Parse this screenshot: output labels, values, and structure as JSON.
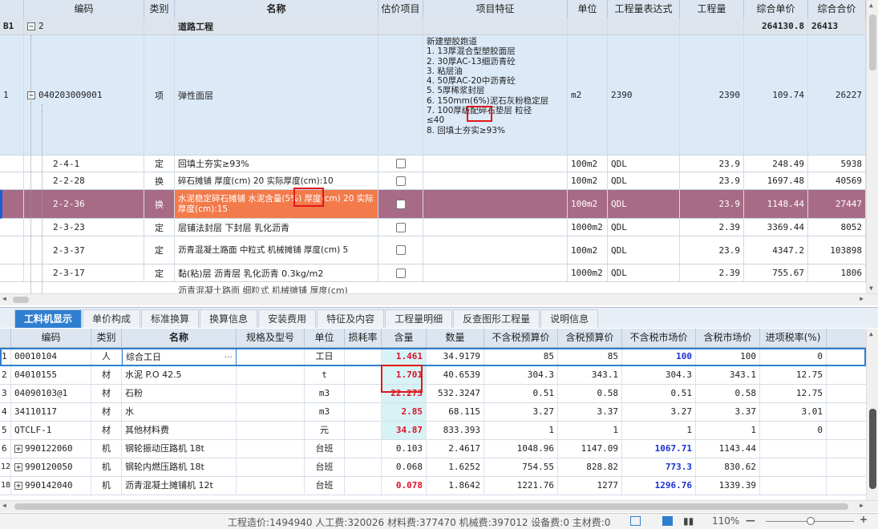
{
  "top_table": {
    "headers": [
      "编码",
      "类别",
      "名称",
      "估价项目",
      "项目特征",
      "单位",
      "工程量表达式",
      "工程量",
      "综合单价",
      "综合合价"
    ],
    "section": {
      "label": "B1",
      "code": "2",
      "name": "道路工程",
      "unit_price": "264130.8",
      "total": "26413"
    },
    "main_item": {
      "row": "1",
      "code": "040203009001",
      "type": "项",
      "name": "弹性面层",
      "features": [
        "新建塑胶跑道",
        "1. 13厚混合型塑胶面层",
        "2. 30厚AC-13细沥青砼",
        "3. 粘层油",
        "4. 50厚AC-20中沥青砼",
        "5. 5厚稀浆封层",
        "6. 150mm(6%)泥石灰粉稳定层",
        "7. 100厚级配碎石垫层 粒径",
        "≤40",
        "8. 回填土夯实≥93%"
      ],
      "unit": "m2",
      "expr": "2390",
      "qty": "2390",
      "unit_price": "109.74",
      "total": "26227"
    },
    "rows": [
      {
        "code": "2-4-1",
        "type": "定",
        "name": "回填土夯实≥93%",
        "unit": "100m2",
        "expr": "QDL",
        "qty": "23.9",
        "unit_price": "248.49",
        "total": "5938"
      },
      {
        "code": "2-2-28",
        "type": "换",
        "name": "碎石摊铺 厚度(cm) 20  实际厚度(cm):10",
        "unit": "100m2",
        "expr": "QDL",
        "qty": "23.9",
        "unit_price": "1697.48",
        "total": "40569"
      },
      {
        "code": "2-2-36",
        "type": "换",
        "name": "水泥稳定碎石摊铺 水泥含量(5%) 厚度(cm) 20  实际厚度(cm):15",
        "unit": "100m2",
        "expr": "QDL",
        "qty": "23.9",
        "unit_price": "1148.44",
        "total": "27447"
      },
      {
        "code": "2-3-23",
        "type": "定",
        "name": "层铺法封层 下封层 乳化沥青",
        "unit": "1000m2",
        "expr": "QDL",
        "qty": "2.39",
        "unit_price": "3369.44",
        "total": "8052"
      },
      {
        "code": "2-3-37",
        "type": "定",
        "name": "沥青混凝土路面 中粒式 机械摊铺 厚度(cm) 5",
        "unit": "100m2",
        "expr": "QDL",
        "qty": "23.9",
        "unit_price": "4347.2",
        "total": "103898"
      },
      {
        "code": "2-3-17",
        "type": "定",
        "name": "黏(粘)层 沥青层 乳化沥青 0.3kg/m2",
        "unit": "1000m2",
        "expr": "QDL",
        "qty": "2.39",
        "unit_price": "755.67",
        "total": "1806"
      }
    ],
    "partial_row": "沥青混凝土路面 细粒式 机械摊铺 厚度(cm)"
  },
  "tabs": [
    "工料机显示",
    "单价构成",
    "标准换算",
    "换算信息",
    "安装费用",
    "特征及内容",
    "工程量明细",
    "反查图形工程量",
    "说明信息"
  ],
  "bottom_table": {
    "headers": [
      "编码",
      "类别",
      "名称",
      "规格及型号",
      "单位",
      "损耗率",
      "含量",
      "数量",
      "不含税预算价",
      "含税预算价",
      "不含税市场价",
      "含税市场价",
      "进项税率(%)"
    ],
    "rows": [
      {
        "n": "1",
        "code": "00010104",
        "type": "人",
        "name": "综合工日",
        "unit": "工日",
        "content": "1.461",
        "qty": "34.9179",
        "p1": "85",
        "p2": "85",
        "p3": "100",
        "p4": "100",
        "tax": "0"
      },
      {
        "n": "2",
        "code": "04010155",
        "type": "材",
        "name": "水泥 P.O 42.5",
        "unit": "t",
        "content": "1.701",
        "qty": "40.6539",
        "p1": "304.3",
        "p2": "343.1",
        "p3": "304.3",
        "p4": "343.1",
        "tax": "12.75"
      },
      {
        "n": "3",
        "code": "04090103@1",
        "type": "材",
        "name": "石粉",
        "unit": "m3",
        "content": "22.273",
        "qty": "532.3247",
        "p1": "0.51",
        "p2": "0.58",
        "p3": "0.51",
        "p4": "0.58",
        "tax": "12.75"
      },
      {
        "n": "4",
        "code": "34110117",
        "type": "材",
        "name": "水",
        "unit": "m3",
        "content": "2.85",
        "qty": "68.115",
        "p1": "3.27",
        "p2": "3.37",
        "p3": "3.27",
        "p4": "3.37",
        "tax": "3.01"
      },
      {
        "n": "5",
        "code": "QTCLF-1",
        "type": "材",
        "name": "其他材料费",
        "unit": "元",
        "content": "34.87",
        "qty": "833.393",
        "p1": "1",
        "p2": "1",
        "p3": "1",
        "p4": "1",
        "tax": "0"
      },
      {
        "n": "6",
        "code": "990122060",
        "type": "机",
        "name": "钢轮振动压路机 18t",
        "unit": "台班",
        "content": "0.103",
        "qty": "2.4617",
        "p1": "1048.96",
        "p2": "1147.09",
        "p3": "1067.71",
        "p4": "1143.44",
        "tax": ""
      },
      {
        "n": "12",
        "code": "990120050",
        "type": "机",
        "name": "钢轮内燃压路机 18t",
        "unit": "台班",
        "content": "0.068",
        "qty": "1.6252",
        "p1": "754.55",
        "p2": "828.82",
        "p3": "773.3",
        "p4": "830.62",
        "tax": ""
      },
      {
        "n": "18",
        "code": "990142040",
        "type": "机",
        "name": "沥青混凝土摊铺机 12t",
        "unit": "台班",
        "content": "0.078",
        "qty": "1.8642",
        "p1": "1221.76",
        "p2": "1277",
        "p3": "1296.76",
        "p4": "1339.39",
        "tax": ""
      }
    ]
  },
  "status": {
    "text": "工程造价:1494940  人工费:320026  材料费:377470  机械费:397012  设备费:0  主材费:0",
    "zoom": "110%"
  },
  "colors": {
    "selected_row": "#a76b86",
    "selected_name": "#f37a4a",
    "accent": "#2f7fd0",
    "red": "#e0102a",
    "blue": "#1832d0"
  }
}
